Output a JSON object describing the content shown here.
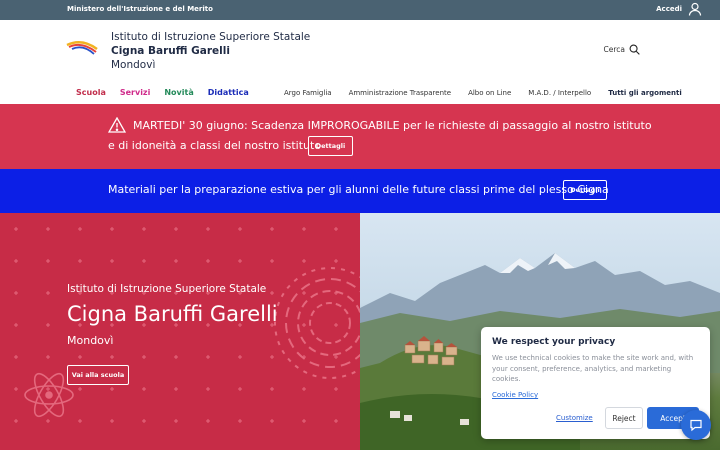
{
  "topbar": {
    "ministry": "Ministero dell'Istruzione e del Merito",
    "login_label": "Accedi"
  },
  "header": {
    "name_line1": "Istituto di Istruzione Superiore Statale",
    "name_line2": "Cigna Baruffi Garelli",
    "name_line3": "Mondovì",
    "search_label": "Cerca"
  },
  "nav": {
    "main": [
      "Scuola",
      "Servizi",
      "Novità",
      "Didattica"
    ],
    "secondary": [
      "Argo Famiglia",
      "Amministrazione Trasparente",
      "Albo on Line",
      "M.A.D. / Interpello",
      "Tutti gli argomenti"
    ]
  },
  "alert": {
    "line1": "MARTEDI' 30 giugno: Scadenza IMPROROGABILE per le richieste di passaggio al nostro istituto",
    "line2": "e di idoneità a classi del nostro istituto",
    "button": "Dettagli"
  },
  "info": {
    "text": "Materiali per la preparazione estiva per gli alunni delle future classi prime del plesso Cigna",
    "button": "Dettagli"
  },
  "hero": {
    "subtitle": "Istituto di Istruzione Superiore Statale",
    "title": "Cigna Baruffi Garelli",
    "city": "Mondovì",
    "button": "Vai alla scuola"
  },
  "cookie": {
    "title": "We respect your privacy",
    "description": "We use technical cookies to make the site work and, with your consent, preference, analytics, and marketing cookies.",
    "policy": "Cookie Policy",
    "customize": "Customize",
    "reject": "Reject",
    "accept": "Accept"
  },
  "colors": {
    "topbar": "#4a6272",
    "alert": "#d63550",
    "info": "#0c1fe6",
    "hero": "#c72c47",
    "accent": "#2a6bd8"
  }
}
